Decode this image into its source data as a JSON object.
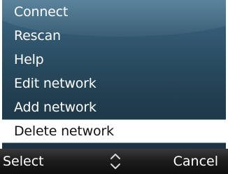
{
  "menu": {
    "items": [
      {
        "label": "Connect"
      },
      {
        "label": "Rescan"
      },
      {
        "label": "Help"
      },
      {
        "label": "Edit network"
      },
      {
        "label": "Add network"
      },
      {
        "label": "Delete network"
      }
    ],
    "selected_label": "Delete network"
  },
  "softkeys": {
    "left_label": "Select",
    "right_label": "Cancel",
    "nav_icon": "up-down-arrows-icon"
  },
  "colors": {
    "menu_background": "#2a4d62",
    "selection_background": "#ffffff",
    "softkey_background": "#1e1e1e",
    "text": "#ffffff"
  }
}
